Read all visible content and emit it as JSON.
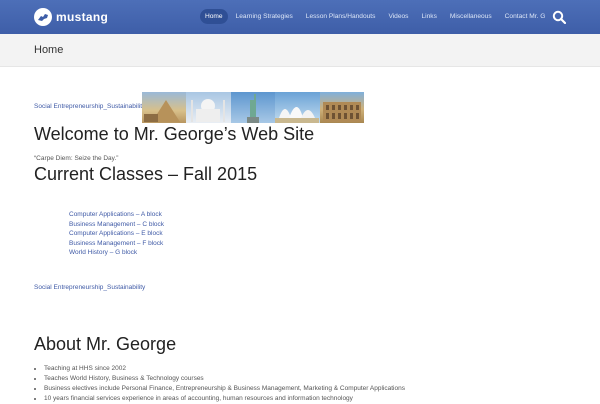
{
  "header": {
    "logo_text": "mustang",
    "nav": [
      {
        "label": "Home",
        "active": true
      },
      {
        "label": "Learning Strategies"
      },
      {
        "label": "Lesson Plans/Handouts"
      },
      {
        "label": "Videos"
      },
      {
        "label": "Links"
      },
      {
        "label": "Miscellaneous"
      },
      {
        "label": "Contact Mr. G"
      }
    ],
    "search_icon": "search-icon"
  },
  "page": {
    "title": "Home"
  },
  "content": {
    "sustainability_link_1": "Social Entrepreneurship_Sustainability",
    "landmarks": [
      "sphinx-pyramid",
      "taj-mahal",
      "statue-of-liberty",
      "sydney-opera-house",
      "colosseum"
    ],
    "welcome_heading": "Welcome to Mr. George’s Web Site",
    "quote": "“Carpe Diem: Seize the Day.”",
    "current_heading": "Current Classes – Fall 2015",
    "classes": [
      "Computer Applications – A block",
      "Business Management – C block",
      "Computer Applications – E block",
      "Business Management – F block",
      "World History – G block"
    ],
    "sustainability_link_2": "Social Entrepreneurship_Sustainability",
    "about_heading": "About Mr. George",
    "about_items": [
      "Teaching at HHS since 2002",
      "Teaches World History, Business & Technology courses",
      "Business electives include Personal Finance, Entrepreneurship & Business Management, Marketing & Computer Applications",
      "10 years financial services experience in areas of accounting, human resources and information technology"
    ]
  },
  "colors": {
    "header_bg": "#4264ad",
    "link": "#3f5aa6"
  }
}
